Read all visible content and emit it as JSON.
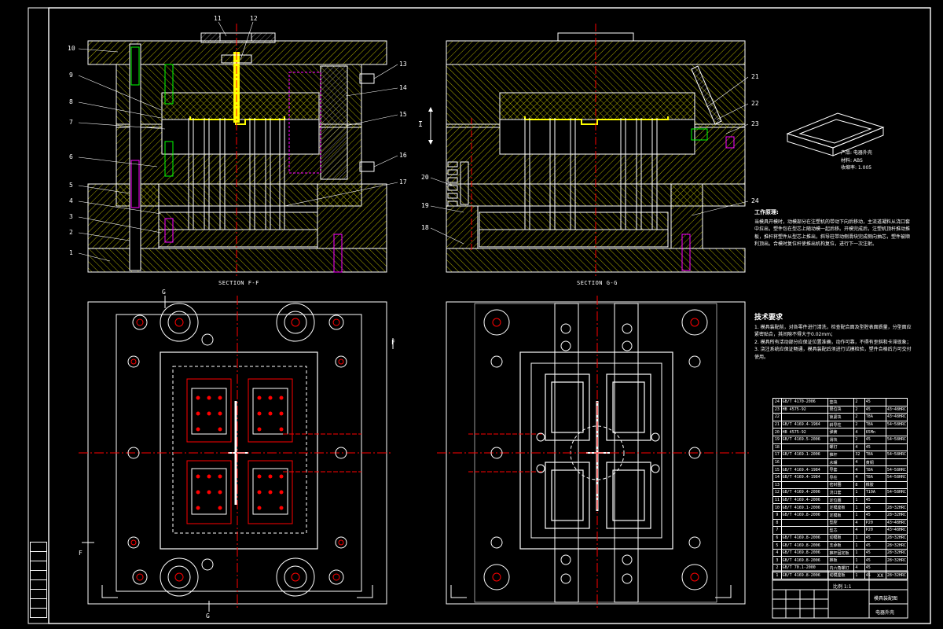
{
  "callouts_left": [
    "1",
    "2",
    "3",
    "4",
    "5",
    "6",
    "7",
    "8",
    "9",
    "10"
  ],
  "callouts_top": [
    "11",
    "12"
  ],
  "callouts_right": [
    "13",
    "14",
    "15",
    "16",
    "17"
  ],
  "callouts_section2": [
    "18",
    "19",
    "20",
    "21",
    "22",
    "23",
    "24"
  ],
  "section_f": "SECTION F-F",
  "section_g": "SECTION G-G",
  "view_mark": "I",
  "cut_marks": {
    "f": "F",
    "g": "G"
  },
  "product": {
    "name": "产品: 电器外壳",
    "material": "材料: ABS",
    "shrink": "收缩率: 1.005"
  },
  "work_process": {
    "title": "工作原理:",
    "text": "当模具开模时，动模部分在注塑机的带动下向后移动，主流道凝料从浇口套中拉出，塑件包在型芯上随动模一起后移。开模完成后，注塑机顶杆推动推板，推杆将塑件从型芯上推出，斜导柱带动侧滑块完成侧向抽芯，塑件被顺利顶出。合模时复位杆使推出机构复位，进行下一次注射。"
  },
  "tech_req": {
    "title": "技术要求",
    "items": [
      "1. 模具装配前，对各零件进行清洗，检查配合面及型腔表面质量，分型面应紧密贴合，其间隙不得大于0.02mm；",
      "2. 模具所有活动部分应保证位置准确，动作可靠，不得有歪斜和卡滞现象；",
      "3. 浇注系统应保证畅通，模具装配后须进行试模检验，塑件合格后方可交付使用。"
    ]
  },
  "bom": [
    {
      "n": "24",
      "std": "GB/T 4170-2006",
      "name": "垫块",
      "qty": "2",
      "mat": "45",
      "note": ""
    },
    {
      "n": "23",
      "std": "HB 4575-92",
      "name": "限位块",
      "qty": "2",
      "mat": "45",
      "note": "43~48HRC"
    },
    {
      "n": "22",
      "std": "",
      "name": "锁紧块",
      "qty": "2",
      "mat": "T8A",
      "note": "43~48HRC"
    },
    {
      "n": "21",
      "std": "GB/T 4169.4-1984",
      "name": "斜导柱",
      "qty": "2",
      "mat": "T8A",
      "note": "54~58HRC"
    },
    {
      "n": "20",
      "std": "HB 4575-92",
      "name": "弹簧",
      "qty": "4",
      "mat": "65Mn",
      "note": ""
    },
    {
      "n": "19",
      "std": "GB/T 4169.5-2006",
      "name": "滑块",
      "qty": "2",
      "mat": "45",
      "note": "54~58HRC"
    },
    {
      "n": "18",
      "std": "",
      "name": "螺钉",
      "qty": "4",
      "mat": "45",
      "note": ""
    },
    {
      "n": "17",
      "std": "GB/T 4169.1-2006",
      "name": "推杆",
      "qty": "32",
      "mat": "T8A",
      "note": "54~58HRC"
    },
    {
      "n": "16",
      "std": "",
      "name": "水嘴",
      "qty": "4",
      "mat": "黄铜",
      "note": ""
    },
    {
      "n": "15",
      "std": "GB/T 4169.4-1984",
      "name": "导套",
      "qty": "4",
      "mat": "T8A",
      "note": "54~58HRC"
    },
    {
      "n": "14",
      "std": "GB/T 4169.4-1984",
      "name": "导柱",
      "qty": "4",
      "mat": "T8A",
      "note": "54~58HRC"
    },
    {
      "n": "13",
      "std": "",
      "name": "密封圈",
      "qty": "8",
      "mat": "橡胶",
      "note": ""
    },
    {
      "n": "12",
      "std": "GB/T 4169.4-2006",
      "name": "浇口套",
      "qty": "1",
      "mat": "T10A",
      "note": "54~58HRC"
    },
    {
      "n": "11",
      "std": "GB/T 4169.4-2006",
      "name": "定位圈",
      "qty": "1",
      "mat": "45",
      "note": ""
    },
    {
      "n": "10",
      "std": "GB/T 4169.1-2006",
      "name": "定模座板",
      "qty": "1",
      "mat": "45",
      "note": "28~32HRC"
    },
    {
      "n": "9",
      "std": "GB/T 4169.8-2006",
      "name": "定模板",
      "qty": "1",
      "mat": "45",
      "note": "28~32HRC"
    },
    {
      "n": "8",
      "std": "",
      "name": "型腔",
      "qty": "4",
      "mat": "P20",
      "note": "43~48HRC"
    },
    {
      "n": "7",
      "std": "",
      "name": "型芯",
      "qty": "4",
      "mat": "P20",
      "note": "43~48HRC"
    },
    {
      "n": "6",
      "std": "GB/T 4169.8-2006",
      "name": "动模板",
      "qty": "1",
      "mat": "45",
      "note": "28~32HRC"
    },
    {
      "n": "5",
      "std": "GB/T 4169.8-2006",
      "name": "支承板",
      "qty": "1",
      "mat": "45",
      "note": "28~32HRC"
    },
    {
      "n": "4",
      "std": "GB/T 4169.8-2006",
      "name": "推杆固定板",
      "qty": "1",
      "mat": "45",
      "note": "28~32HRC"
    },
    {
      "n": "3",
      "std": "GB/T 4169.8-2006",
      "name": "推板",
      "qty": "1",
      "mat": "45",
      "note": "28~32HRC"
    },
    {
      "n": "2",
      "std": "GB/T 70.1-2000",
      "name": "内六角螺钉",
      "qty": "4",
      "mat": "45",
      "note": ""
    },
    {
      "n": "1",
      "std": "GB/T 4169.8-2006",
      "name": "动模座板",
      "qty": "1",
      "mat": "45",
      "note": "28~32HRC"
    }
  ],
  "title_block": {
    "drawing_title": "模具装配图",
    "school": "XX",
    "scale": "比例 1:1",
    "part_name": "电器外壳"
  },
  "colors": {
    "bg": "#000000",
    "line": "#ffffff",
    "hatch": "#ffff00",
    "center": "#ff0000",
    "accent_magenta": "#ff00ff",
    "accent_cyan": "#00ffff"
  }
}
